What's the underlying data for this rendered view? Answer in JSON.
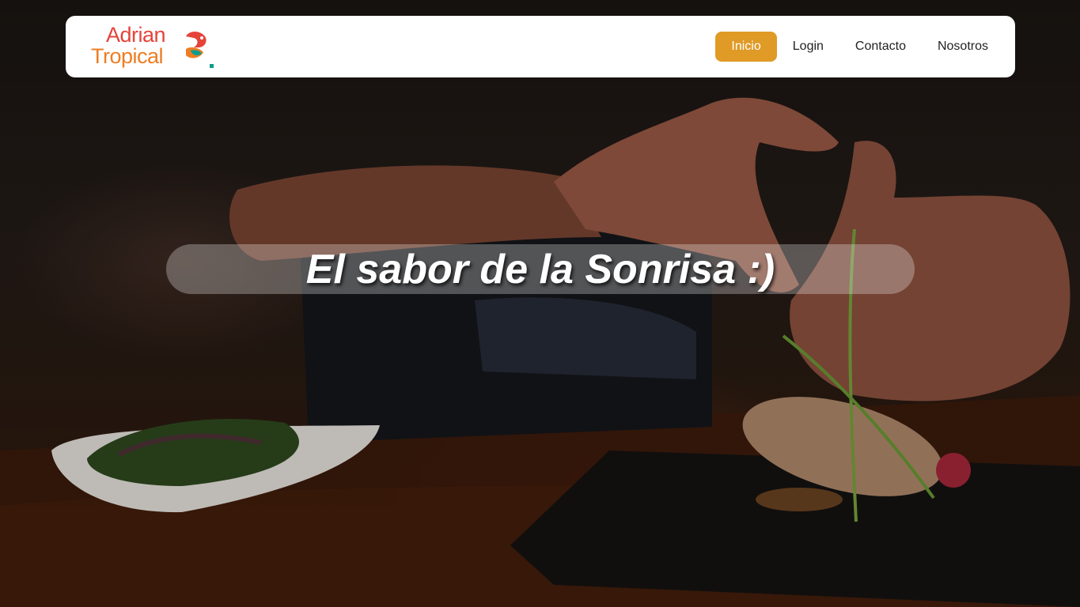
{
  "hero": {
    "tagline": "El sabor de la Sonrisa :)",
    "image": "chef-plating-food"
  },
  "header": {
    "logo": {
      "line1": "Adrian",
      "line2": "Tropical",
      "icon": "parrot-icon"
    },
    "nav": [
      {
        "label": "Inicio",
        "active": true
      },
      {
        "label": "Login",
        "active": false
      },
      {
        "label": "Contacto",
        "active": false
      },
      {
        "label": "Nosotros",
        "active": false
      }
    ]
  },
  "colors": {
    "accent": "#e09a26",
    "logo_red": "#e5433a",
    "logo_orange": "#ee7d22",
    "logo_teal": "#0f9c8c"
  }
}
